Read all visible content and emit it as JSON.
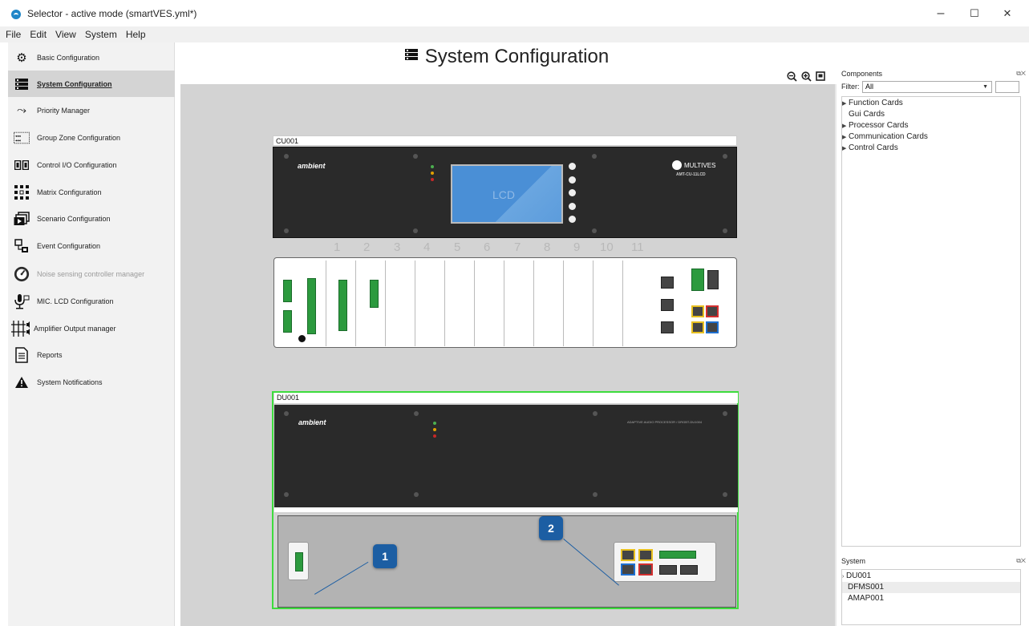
{
  "window": {
    "title": "Selector - active mode (smartVES.yml*)",
    "controls": {
      "minimize": "–",
      "maximize": "☐",
      "close": "✕"
    }
  },
  "menu": [
    "File",
    "Edit",
    "View",
    "System",
    "Help"
  ],
  "sidebar": {
    "items": [
      {
        "label": "Basic Configuration",
        "icon": "gear-icon"
      },
      {
        "label": "System Configuration",
        "icon": "server-rack-icon",
        "active": true
      },
      {
        "label": "Priority Manager",
        "icon": "merge-arrow-icon"
      },
      {
        "label": "Group Zone Configuration",
        "icon": "speaker-group-icon"
      },
      {
        "label": "Control I/O Configuration",
        "icon": "control-io-icon"
      },
      {
        "label": "Matrix Configuration",
        "icon": "matrix-grid-icon"
      },
      {
        "label": "Scenario Configuration",
        "icon": "scenario-icon"
      },
      {
        "label": "Event Configuration",
        "icon": "event-icon"
      },
      {
        "label": "Noise sensing controller manager",
        "icon": "noise-sensor-icon",
        "disabled": true
      },
      {
        "label": "MIC. LCD Configuration",
        "icon": "microphone-icon"
      },
      {
        "label": "Amplifier Output manager",
        "icon": "amplifier-icon"
      },
      {
        "label": "Reports",
        "icon": "document-icon"
      },
      {
        "label": "System Notifications",
        "icon": "warning-icon"
      }
    ]
  },
  "main": {
    "title": "System Configuration",
    "zoom_tools": [
      "zoom-out-icon",
      "zoom-in-icon",
      "fit-icon"
    ],
    "devices": [
      {
        "label": "CU001",
        "logo": "ambient",
        "brand": "MULTIVES",
        "model": "AMT-CU-11LCD",
        "lcd_text": "LCD",
        "slots": [
          "1",
          "2",
          "3",
          "4",
          "5",
          "6",
          "7",
          "8",
          "9",
          "10",
          "11"
        ]
      },
      {
        "label": "DU001",
        "logo": "ambient",
        "model": "ADAPTIVE AUDIO PROCESSOR / DRGBT-DU1004"
      }
    ],
    "callouts": [
      "1",
      "2"
    ]
  },
  "components": {
    "title": "Components",
    "filter_label": "Filter:",
    "filter_value": "All",
    "items": [
      {
        "label": "Function Cards",
        "expandable": true
      },
      {
        "label": "Gui Cards",
        "expandable": false
      },
      {
        "label": "Processor Cards",
        "expandable": true
      },
      {
        "label": "Communication Cards",
        "expandable": true
      },
      {
        "label": "Control Cards",
        "expandable": true
      }
    ]
  },
  "system": {
    "title": "System",
    "items": [
      {
        "label": "DU001",
        "expandable": true,
        "level": 0
      },
      {
        "label": "DFMS001",
        "expandable": false,
        "level": 1,
        "selected": true
      },
      {
        "label": "AMAP001",
        "expandable": false,
        "level": 1
      }
    ]
  },
  "colors": {
    "accent": "#1c5ea3",
    "selection_green": "#3ddc3d",
    "canvas_bg": "#d3d3d3",
    "panel_dark": "#2a2a2a"
  }
}
